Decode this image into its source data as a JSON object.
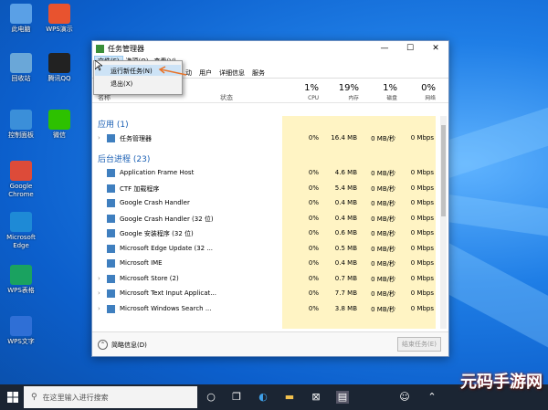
{
  "desktop_icons": [
    {
      "label": "此电脑",
      "icon": "computer-icon",
      "color": "#5aa0e6"
    },
    {
      "label": "WPS演示",
      "icon": "wps-presentation-icon",
      "color": "#e8532f"
    },
    {
      "label": "回收站",
      "icon": "recycle-bin-icon",
      "color": "#6aa7d8"
    },
    {
      "label": "腾讯QQ",
      "icon": "qq-icon",
      "color": "#222222"
    },
    {
      "label": "控制面板",
      "icon": "control-panel-icon",
      "color": "#3b8fd9"
    },
    {
      "label": "微信",
      "icon": "wechat-icon",
      "color": "#2dc100"
    },
    {
      "label": "Google\nChrome",
      "icon": "chrome-icon",
      "color": "#dd4b39"
    },
    {
      "label": "Microsoft\nEdge",
      "icon": "edge-icon",
      "color": "#1e8ad6"
    },
    {
      "label": "WPS表格",
      "icon": "wps-spreadsheet-icon",
      "color": "#1aa260"
    },
    {
      "label": "WPS文字",
      "icon": "wps-writer-icon",
      "color": "#2f6fd6"
    }
  ],
  "window": {
    "title": "任务管理器",
    "minimize": "—",
    "maximize": "☐",
    "close": "✕",
    "menu": {
      "file": "文件(F)",
      "options": "选项(O)",
      "view": "查看(V)"
    },
    "tabs": [
      "动",
      "用户",
      "详细信息",
      "服务"
    ],
    "columns": {
      "name": "名称",
      "status": "状态",
      "cpu": {
        "pct": "1%",
        "label": "CPU"
      },
      "mem": {
        "pct": "19%",
        "label": "内存"
      },
      "disk": {
        "pct": "1%",
        "label": "磁盘"
      },
      "net": {
        "pct": "0%",
        "label": "网络"
      }
    },
    "groups": {
      "apps": "应用 (1)",
      "background": "后台进程 (23)"
    },
    "app_rows": [
      {
        "name": "任务管理器",
        "cpu": "0%",
        "mem": "16.4 MB",
        "disk": "0 MB/秒",
        "net": "0 Mbps",
        "expandable": true
      }
    ],
    "bg_rows": [
      {
        "name": "Application Frame Host",
        "cpu": "0%",
        "mem": "4.6 MB",
        "disk": "0 MB/秒",
        "net": "0 Mbps",
        "expandable": false
      },
      {
        "name": "CTF 加载程序",
        "cpu": "0%",
        "mem": "5.4 MB",
        "disk": "0 MB/秒",
        "net": "0 Mbps",
        "expandable": false
      },
      {
        "name": "Google Crash Handler",
        "cpu": "0%",
        "mem": "0.4 MB",
        "disk": "0 MB/秒",
        "net": "0 Mbps",
        "expandable": false
      },
      {
        "name": "Google Crash Handler (32 位)",
        "cpu": "0%",
        "mem": "0.4 MB",
        "disk": "0 MB/秒",
        "net": "0 Mbps",
        "expandable": false
      },
      {
        "name": "Google 安装程序 (32 位)",
        "cpu": "0%",
        "mem": "0.6 MB",
        "disk": "0 MB/秒",
        "net": "0 Mbps",
        "expandable": false
      },
      {
        "name": "Microsoft Edge Update (32 ...",
        "cpu": "0%",
        "mem": "0.5 MB",
        "disk": "0 MB/秒",
        "net": "0 Mbps",
        "expandable": false
      },
      {
        "name": "Microsoft IME",
        "cpu": "0%",
        "mem": "0.4 MB",
        "disk": "0 MB/秒",
        "net": "0 Mbps",
        "expandable": false
      },
      {
        "name": "Microsoft Store (2)",
        "cpu": "0%",
        "mem": "0.7 MB",
        "disk": "0 MB/秒",
        "net": "0 Mbps",
        "expandable": true
      },
      {
        "name": "Microsoft Text Input Applicat...",
        "cpu": "0%",
        "mem": "7.7 MB",
        "disk": "0 MB/秒",
        "net": "0 Mbps",
        "expandable": true
      },
      {
        "name": "Microsoft Windows Search ...",
        "cpu": "0%",
        "mem": "3.8 MB",
        "disk": "0 MB/秒",
        "net": "0 Mbps",
        "expandable": true
      }
    ],
    "footer": {
      "fewer": "简略信息(D)",
      "end_task": "结束任务(E)"
    }
  },
  "file_menu": {
    "run_new_task": "运行新任务(N)",
    "exit": "退出(X)"
  },
  "taskbar": {
    "search_placeholder": "在这里输入进行搜索"
  },
  "watermark": "元码手游网"
}
